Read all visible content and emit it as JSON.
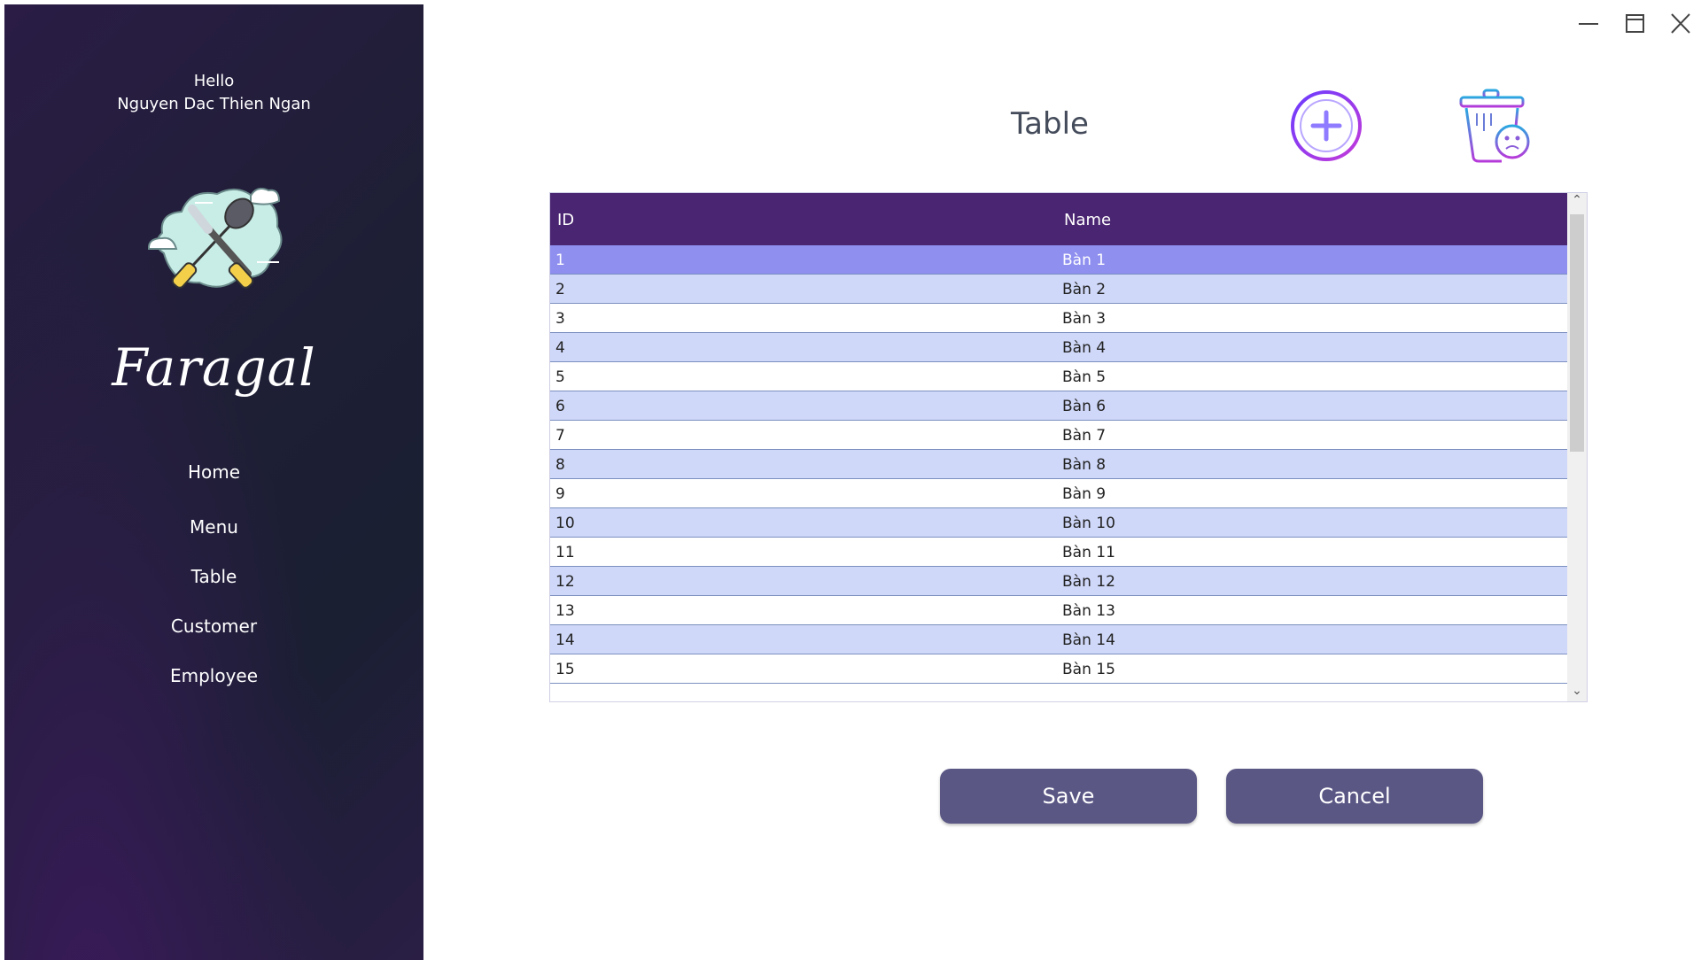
{
  "sidebar": {
    "greeting": "Hello",
    "user_name": "Nguyen Dac Thien Ngan",
    "brand": "Faragal",
    "nav": [
      "Home",
      "Menu",
      "Table",
      "Customer",
      "Employee"
    ]
  },
  "header": {
    "title": "Table"
  },
  "grid": {
    "columns": [
      "ID",
      "Name"
    ],
    "rows": [
      {
        "id": "1",
        "name": "Bàn 1"
      },
      {
        "id": "2",
        "name": "Bàn 2"
      },
      {
        "id": "3",
        "name": "Bàn 3"
      },
      {
        "id": "4",
        "name": "Bàn 4"
      },
      {
        "id": "5",
        "name": "Bàn 5"
      },
      {
        "id": "6",
        "name": "Bàn 6"
      },
      {
        "id": "7",
        "name": "Bàn 7"
      },
      {
        "id": "8",
        "name": "Bàn 8"
      },
      {
        "id": "9",
        "name": "Bàn 9"
      },
      {
        "id": "10",
        "name": "Bàn 10"
      },
      {
        "id": "11",
        "name": "Bàn 11"
      },
      {
        "id": "12",
        "name": "Bàn 12"
      },
      {
        "id": "13",
        "name": "Bàn 13"
      },
      {
        "id": "14",
        "name": "Bàn 14"
      },
      {
        "id": "15",
        "name": "Bàn 15"
      }
    ],
    "selected_row": 0
  },
  "buttons": {
    "save": "Save",
    "cancel": "Cancel"
  },
  "icons": {
    "add": "plus-circle-icon",
    "delete": "trash-can-icon",
    "logo": "crossed-knife-spoon-icon",
    "minimize": "minimize-icon",
    "maximize": "maximize-icon",
    "close": "close-icon"
  },
  "colors": {
    "sidebar_bg": "#1e1f35",
    "header_bg": "#4a2571",
    "selected_row": "#8f8ff0",
    "alt_row": "#cfd8f8",
    "button_bg": "#5a5785"
  }
}
